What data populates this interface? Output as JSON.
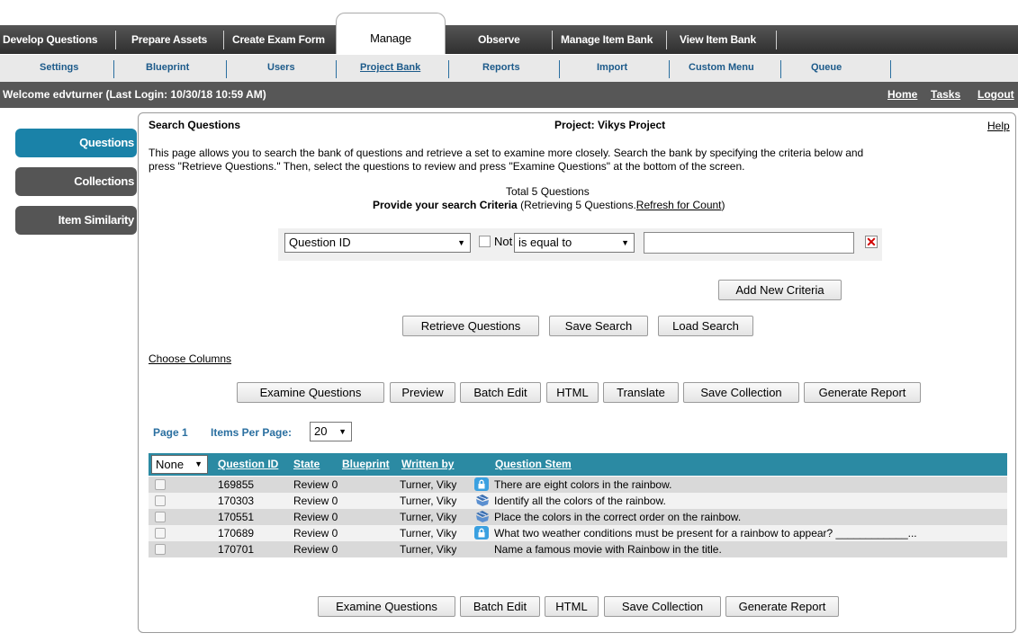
{
  "main_nav": {
    "tabs": [
      "Develop Questions",
      "Prepare Assets",
      "Create Exam Form",
      "Manage",
      "Observe",
      "Manage Item Bank",
      "View Item Bank"
    ]
  },
  "sub_nav": {
    "tabs": [
      "Settings",
      "Blueprint",
      "Users",
      "Project Bank",
      "Reports",
      "Import",
      "Custom Menu",
      "Queue"
    ]
  },
  "welcome": {
    "text": "Welcome edvturner (Last Login: 10/30/18   10:59 AM)",
    "links": [
      "Home",
      "Tasks",
      "Logout"
    ]
  },
  "sidebar": {
    "items": [
      "Questions",
      "Collections",
      "Item Similarity"
    ]
  },
  "panel": {
    "title": "Search Questions",
    "project": "Project: Vikys Project",
    "help": "Help",
    "description_1": "This page allows you to search the bank of questions and retrieve a set to examine more closely. Search the bank by specifying the criteria below and",
    "description_2": "press \"Retrieve Questions.\" Then, select the questions to review and press \"Examine Questions\" at the bottom of the screen.",
    "total": "Total 5 Questions",
    "criteria_label": "Provide your search Criteria",
    "criteria_suffix": " (Retrieving 5 Questions.",
    "refresh_link": "Refresh for Count",
    "criteria_close": ")"
  },
  "criteria": {
    "field": "Question ID",
    "not_label": "Not",
    "operator": "is equal to",
    "value": ""
  },
  "buttons": {
    "add_criteria": "Add New Criteria",
    "retrieve": "Retrieve Questions",
    "save_search": "Save Search",
    "load_search": "Load Search",
    "choose_columns": "Choose Columns",
    "examine": "Examine Questions",
    "preview": "Preview",
    "batch_edit": "Batch Edit",
    "html": "HTML",
    "translate": "Translate",
    "save_collection": "Save Collection",
    "generate_report": "Generate Report"
  },
  "paging": {
    "page": "Page 1",
    "items_label": "Items Per Page:",
    "items_value": "20"
  },
  "table": {
    "select_value": "None",
    "headers": [
      "Question ID",
      "State",
      "Blueprint",
      "Written by",
      "Question Stem"
    ],
    "rows": [
      {
        "id": "169855",
        "state": "Review 0",
        "author": "Turner, Viky",
        "icon": "lock-icon",
        "stem": "There are eight colors in the rainbow."
      },
      {
        "id": "170303",
        "state": "Review 0",
        "author": "Turner, Viky",
        "icon": "drag-drop-icon",
        "stem": "Identify all the colors of the rainbow."
      },
      {
        "id": "170551",
        "state": "Review 0",
        "author": "Turner, Viky",
        "icon": "drag-drop-icon",
        "stem": "Place the colors in the correct order on the rainbow."
      },
      {
        "id": "170689",
        "state": "Review 0",
        "author": "Turner, Viky",
        "icon": "lock-icon",
        "stem": "What two weather conditions must be present for a rainbow to appear? ____________..."
      },
      {
        "id": "170701",
        "state": "Review 0",
        "author": "Turner, Viky",
        "icon": "",
        "stem": "Name a famous movie with Rainbow in the title."
      }
    ]
  },
  "colors": {
    "accent_teal": "#2b8aa3",
    "sidebar_active": "#1a82a8",
    "sidebar_inactive": "#555555",
    "link_blue": "#1c5a8a",
    "row_odd": "#d9d9d9",
    "row_even": "#f2f2f2",
    "delete_red": "#d00000"
  }
}
